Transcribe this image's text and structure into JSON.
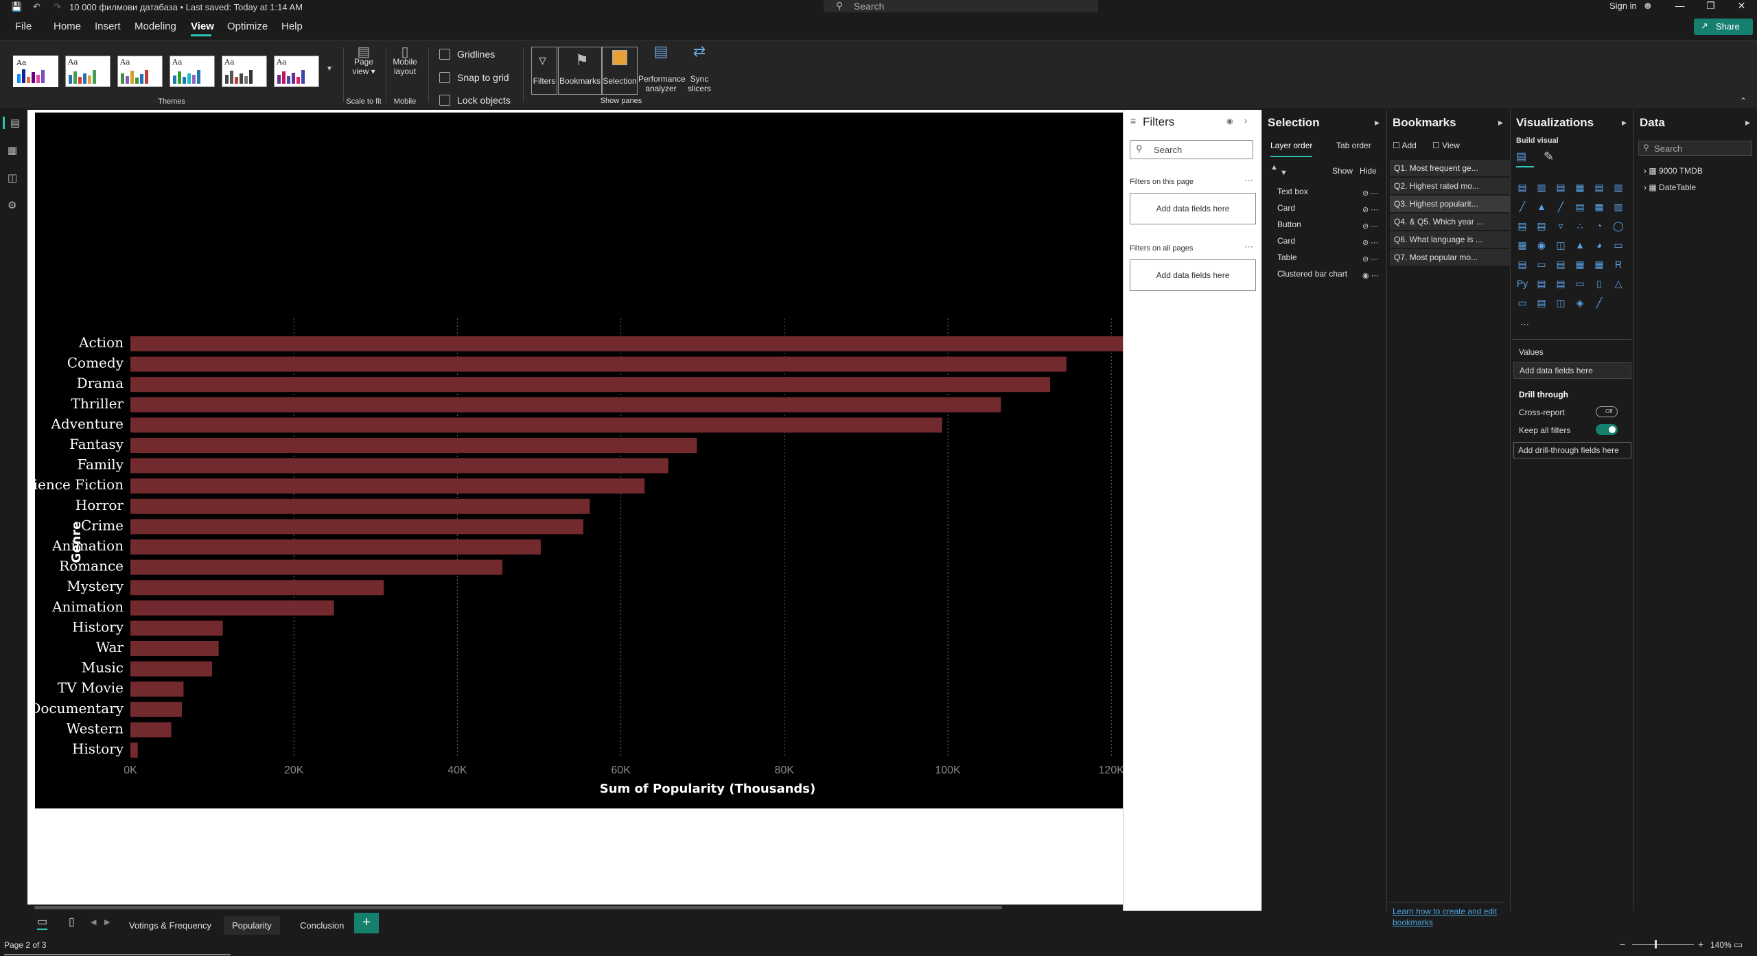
{
  "window": {
    "doc_title": "10 000 филмови датабаза • Last saved: Today at 1:14 AM",
    "search_placeholder": "Search",
    "signin": "Sign in"
  },
  "menu": [
    "File",
    "Home",
    "Insert",
    "Modeling",
    "View",
    "Optimize",
    "Help"
  ],
  "share_label": "Share",
  "ribbon": {
    "themes_label": "Themes",
    "theme_swatch_text": "Aa",
    "page_view": "Page view",
    "scale_to_fit": "Scale to fit",
    "mobile_layout": "Mobile layout",
    "mobile": "Mobile",
    "gridlines": "Gridlines",
    "snap_to_grid": "Snap to grid",
    "lock_objects": "Lock objects",
    "panes": [
      "Filters",
      "Bookmarks",
      "Selection",
      "Performance analyzer",
      "Sync slicers"
    ],
    "show_panes": "Show panes"
  },
  "filters": {
    "title": "Filters",
    "search_placeholder": "Search",
    "on_this_page": "Filters on this page",
    "on_all_pages": "Filters on all pages",
    "add_fields": "Add data fields here"
  },
  "selection": {
    "title": "Selection",
    "layer_order": "Layer order",
    "tab_order": "Tab order",
    "show": "Show",
    "hide": "Hide",
    "layers": [
      "Text box",
      "Card",
      "Button",
      "Card",
      "Table",
      "Clustered bar chart"
    ]
  },
  "bookmarks": {
    "title": "Bookmarks",
    "add": "Add",
    "view": "View",
    "items": [
      "Q1. Most frequent ge...",
      "Q2. Highest rated mo...",
      "Q3. Highest popularit...",
      "Q4. & Q5. Which year ...",
      "Q6. What language is ...",
      "Q7. Most popular mo..."
    ],
    "help_link": "Learn how to create and edit bookmarks"
  },
  "visualizations": {
    "title": "Visualizations",
    "build_visual": "Build visual",
    "values": "Values",
    "add_fields": "Add data fields here",
    "drill_through": "Drill through",
    "cross_report": "Cross-report",
    "off": "Off",
    "keep_all_filters": "Keep all filters",
    "add_drill": "Add drill-through fields here"
  },
  "data_pane": {
    "title": "Data",
    "search_placeholder": "Search",
    "tables": [
      "9000 TMDB",
      "DateTable"
    ]
  },
  "page_tabs": [
    "Votings & Frequency",
    "Popularity",
    "Conclusion"
  ],
  "active_tab": "Popularity",
  "status": {
    "page": "Page 2 of 3",
    "zoom": "140%"
  },
  "colors": {
    "accent": "#2ec4b6",
    "bar": "#722a2f",
    "report_bg": "#000000"
  },
  "chart_data": {
    "type": "bar",
    "orientation": "horizontal",
    "xlabel": "Sum of Popularity (Thousands)",
    "ylabel": "Genre",
    "xlim": [
      0,
      123000
    ],
    "ticks": [
      "0K",
      "20K",
      "40K",
      "60K",
      "80K",
      "100K",
      "120K"
    ],
    "tick_values": [
      0,
      20000,
      40000,
      60000,
      80000,
      100000,
      120000
    ],
    "grid": "vertical dotted",
    "categories": [
      "Action",
      "Comedy",
      "Drama",
      "Thriller",
      "Adventure",
      "Fantasy",
      "Family",
      "Science Fiction",
      "Horror",
      "Crime",
      "Animation",
      "Romance",
      "Mystery",
      "Animation",
      "History",
      "War",
      "Music",
      "TV Movie",
      "Documentary",
      "Western",
      "History"
    ],
    "values": [
      123500,
      114500,
      112500,
      106500,
      99300,
      69300,
      65800,
      62900,
      56200,
      55400,
      50200,
      45500,
      31000,
      24900,
      11300,
      10800,
      10000,
      6500,
      6300,
      5000,
      900
    ]
  }
}
